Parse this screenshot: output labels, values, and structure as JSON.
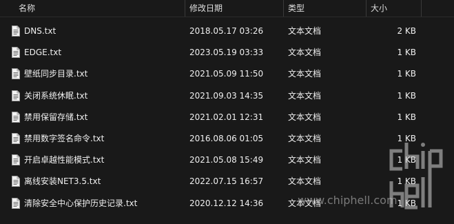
{
  "columns": {
    "name": "名称",
    "modified": "修改日期",
    "type": "类型",
    "size": "大小"
  },
  "sort_indicator": "^",
  "files": [
    {
      "name": "DNS.txt",
      "modified": "2018.05.17 03:26",
      "type": "文本文档",
      "size": "2 KB"
    },
    {
      "name": "EDGE.txt",
      "modified": "2023.05.19 03:33",
      "type": "文本文档",
      "size": "1 KB"
    },
    {
      "name": "壁纸同步目录.txt",
      "modified": "2021.05.09 11:50",
      "type": "文本文档",
      "size": "1 KB"
    },
    {
      "name": "关闭系统休眠.txt",
      "modified": "2021.09.03 14:35",
      "type": "文本文档",
      "size": "1 KB"
    },
    {
      "name": "禁用保留存储.txt",
      "modified": "2021.02.01 12:31",
      "type": "文本文档",
      "size": "1 KB"
    },
    {
      "name": "禁用数字签名命令.txt",
      "modified": "2016.08.06 01:05",
      "type": "文本文档",
      "size": "1 KB"
    },
    {
      "name": "开启卓越性能模式.txt",
      "modified": "2021.05.08 15:49",
      "type": "文本文档",
      "size": "1 KB"
    },
    {
      "name": "离线安装NET3.5.txt",
      "modified": "2022.07.15 16:57",
      "type": "文本文档",
      "size": "1 KB"
    },
    {
      "name": "清除安全中心保护历史记录.txt",
      "modified": "2020.12.12 14:36",
      "type": "文本文档",
      "size": "1 KB"
    }
  ],
  "watermark": "www.chiphell.com",
  "file_icon": "text-document-icon",
  "logo_text": "chip hell"
}
